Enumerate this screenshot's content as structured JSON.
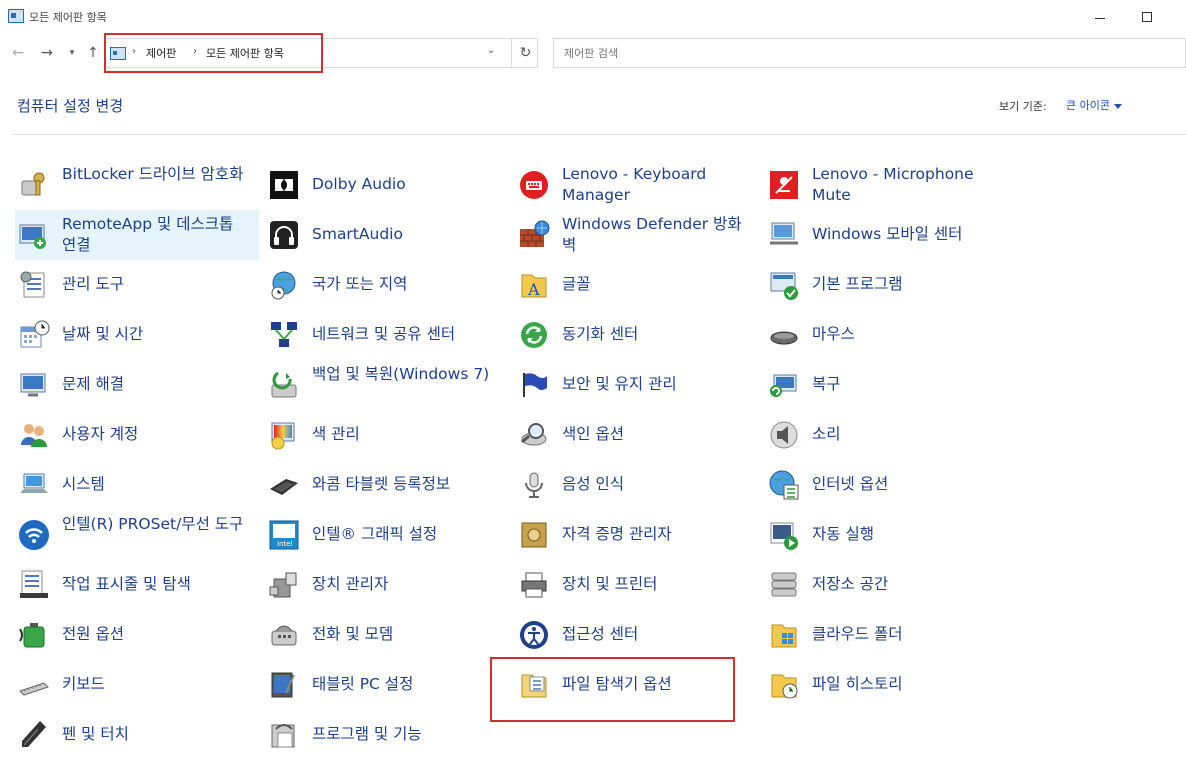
{
  "window": {
    "title": "모든 제어판 항목"
  },
  "nav": {
    "breadcrumb": [
      "제어판",
      "모든 제어판 항목"
    ],
    "search_placeholder": "제어판 검색"
  },
  "header": {
    "title": "컴퓨터 설정 변경",
    "view_by_label": "보기 기준:",
    "view_by_value": "큰 아이콘"
  },
  "items": [
    {
      "label": "BitLocker 드라이브 암호화",
      "icon": "bitlocker-key-icon"
    },
    {
      "label": "Dolby Audio",
      "icon": "dolby-icon"
    },
    {
      "label": "Lenovo - Keyboard Manager",
      "icon": "keyboard-manager-icon"
    },
    {
      "label": "Lenovo - Microphone Mute",
      "icon": "microphone-mute-icon"
    },
    {
      "label": "RemoteApp 및 데스크톱 연결",
      "icon": "remoteapp-icon"
    },
    {
      "label": "SmartAudio",
      "icon": "headphones-icon"
    },
    {
      "label": "Windows Defender 방화벽",
      "icon": "firewall-brick-icon"
    },
    {
      "label": "Windows 모바일 센터",
      "icon": "mobility-center-icon"
    },
    {
      "label": "관리 도구",
      "icon": "admin-tools-icon"
    },
    {
      "label": "국가 또는 지역",
      "icon": "globe-clock-icon"
    },
    {
      "label": "글꼴",
      "icon": "fonts-folder-icon"
    },
    {
      "label": "기본 프로그램",
      "icon": "default-programs-icon"
    },
    {
      "label": "날짜 및 시간",
      "icon": "calendar-clock-icon"
    },
    {
      "label": "네트워크 및 공유 센터",
      "icon": "network-icon"
    },
    {
      "label": "동기화 센터",
      "icon": "sync-icon"
    },
    {
      "label": "마우스",
      "icon": "mouse-icon"
    },
    {
      "label": "문제 해결",
      "icon": "troubleshoot-icon"
    },
    {
      "label": "백업 및 복원(Windows 7)",
      "icon": "backup-icon"
    },
    {
      "label": "보안 및 유지 관리",
      "icon": "flag-icon"
    },
    {
      "label": "복구",
      "icon": "recovery-icon"
    },
    {
      "label": "사용자 계정",
      "icon": "users-icon"
    },
    {
      "label": "색 관리",
      "icon": "color-management-icon"
    },
    {
      "label": "색인 옵션",
      "icon": "indexing-icon"
    },
    {
      "label": "소리",
      "icon": "speaker-icon"
    },
    {
      "label": "시스템",
      "icon": "system-laptop-icon"
    },
    {
      "label": "와콤 타블렛 등록정보",
      "icon": "wacom-tablet-icon"
    },
    {
      "label": "음성 인식",
      "icon": "microphone-icon"
    },
    {
      "label": "인터넷 옵션",
      "icon": "internet-options-icon"
    },
    {
      "label": "인텔(R) PROSet/무선 도구",
      "icon": "wireless-icon"
    },
    {
      "label": "인텔® 그래픽 설정",
      "icon": "intel-graphics-icon"
    },
    {
      "label": "자격 증명 관리자",
      "icon": "credential-safe-icon"
    },
    {
      "label": "자동 실행",
      "icon": "autoplay-icon"
    },
    {
      "label": "작업 표시줄 및 탐색",
      "icon": "taskbar-icon"
    },
    {
      "label": "장치 관리자",
      "icon": "device-manager-icon"
    },
    {
      "label": "장치 및 프린터",
      "icon": "printer-icon"
    },
    {
      "label": "저장소 공간",
      "icon": "storage-spaces-icon"
    },
    {
      "label": "전원 옵션",
      "icon": "power-battery-icon"
    },
    {
      "label": "전화 및 모뎀",
      "icon": "phone-modem-icon"
    },
    {
      "label": "접근성 센터",
      "icon": "accessibility-icon"
    },
    {
      "label": "클라우드 폴더",
      "icon": "cloud-folder-icon"
    },
    {
      "label": "키보드",
      "icon": "keyboard-icon"
    },
    {
      "label": "태블릿 PC 설정",
      "icon": "tablet-pc-icon"
    },
    {
      "label": "파일 탐색기 옵션",
      "icon": "file-explorer-options-icon"
    },
    {
      "label": "파일 히스토리",
      "icon": "file-history-icon"
    },
    {
      "label": "펜 및 터치",
      "icon": "pen-icon"
    },
    {
      "label": "프로그램 및 기능",
      "icon": "programs-features-icon"
    }
  ],
  "colors": {
    "link": "#1e3f8a",
    "accent": "#1e4fb5",
    "highlight": "#d32f2f",
    "hover": "#e5f3fb"
  }
}
